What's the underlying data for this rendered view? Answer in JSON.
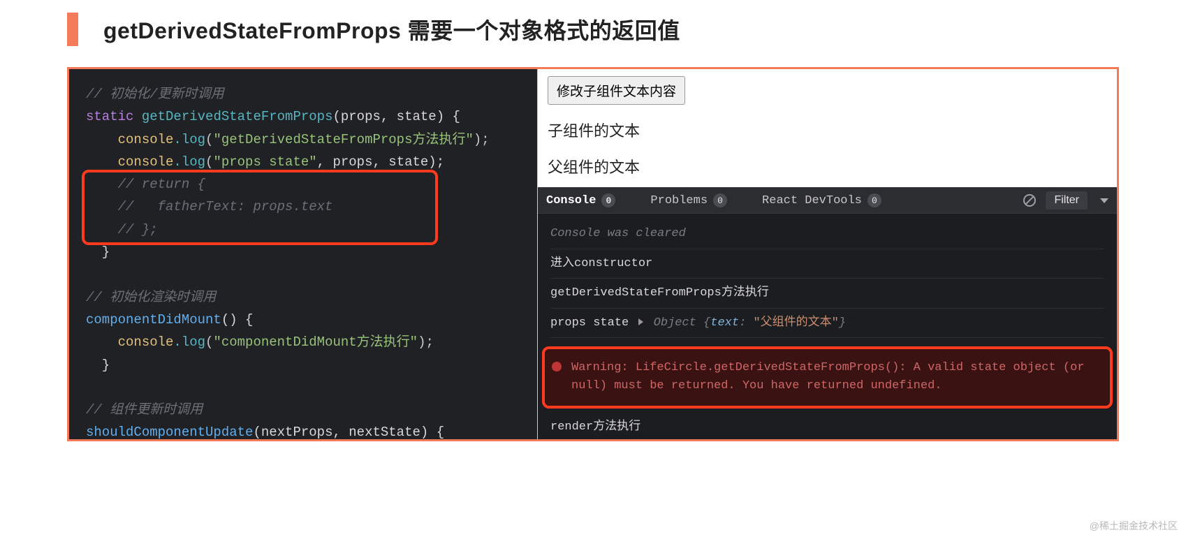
{
  "heading": "getDerivedStateFromProps 需要一个对象格式的返回值",
  "code": {
    "c1": "// 初始化/更新时调用",
    "l1_kw": "static",
    "l1_fn": " getDerivedStateFromProps",
    "l1_args": "(props, state) {",
    "l2a": "    console",
    "l2b": ".log",
    "l2c": "(",
    "l2d": "\"getDerivedStateFromProps方法执行\"",
    "l2e": ");",
    "l3a": "    console",
    "l3b": ".log",
    "l3c": "(",
    "l3d": "\"props state\"",
    "l3e": ", props, state);",
    "l4": "    // return {",
    "l5": "    //   fatherText: props.text",
    "l6": "    // };",
    "l7": "  }",
    "c2": "// 初始化渲染时调用",
    "l8a": "componentDidMount",
    "l8b": "() {",
    "l9a": "    console",
    "l9b": ".log",
    "l9c": "(",
    "l9d": "\"componentDidMount方法执行\"",
    "l9e": ");",
    "l10": "  }",
    "c3": "// 组件更新时调用",
    "l11a": "shouldComponentUpdate",
    "l11b": "(nextProps, nextState) {"
  },
  "app": {
    "button": "修改子组件文本内容",
    "childText": "子组件的文本",
    "parentText": "父组件的文本"
  },
  "devtools": {
    "tabs": {
      "console": "Console",
      "consoleCount": "0",
      "problems": "Problems",
      "problemsCount": "0",
      "react": "React DevTools",
      "reactCount": "0"
    },
    "filter": "Filter",
    "lines": {
      "cleared": "Console was cleared",
      "l1": "进入constructor",
      "l2": "getDerivedStateFromProps方法执行",
      "l3a": "props state  ",
      "l3obj": "Object {",
      "l3key": "text",
      "l3sep": ": ",
      "l3val": "\"父组件的文本\"",
      "l3end": "}",
      "l4": "render方法执行"
    },
    "warning": "Warning: LifeCircle.getDerivedStateFromProps(): A valid state object (or null) must be returned. You have returned undefined."
  },
  "watermark": "@稀土掘金技术社区"
}
